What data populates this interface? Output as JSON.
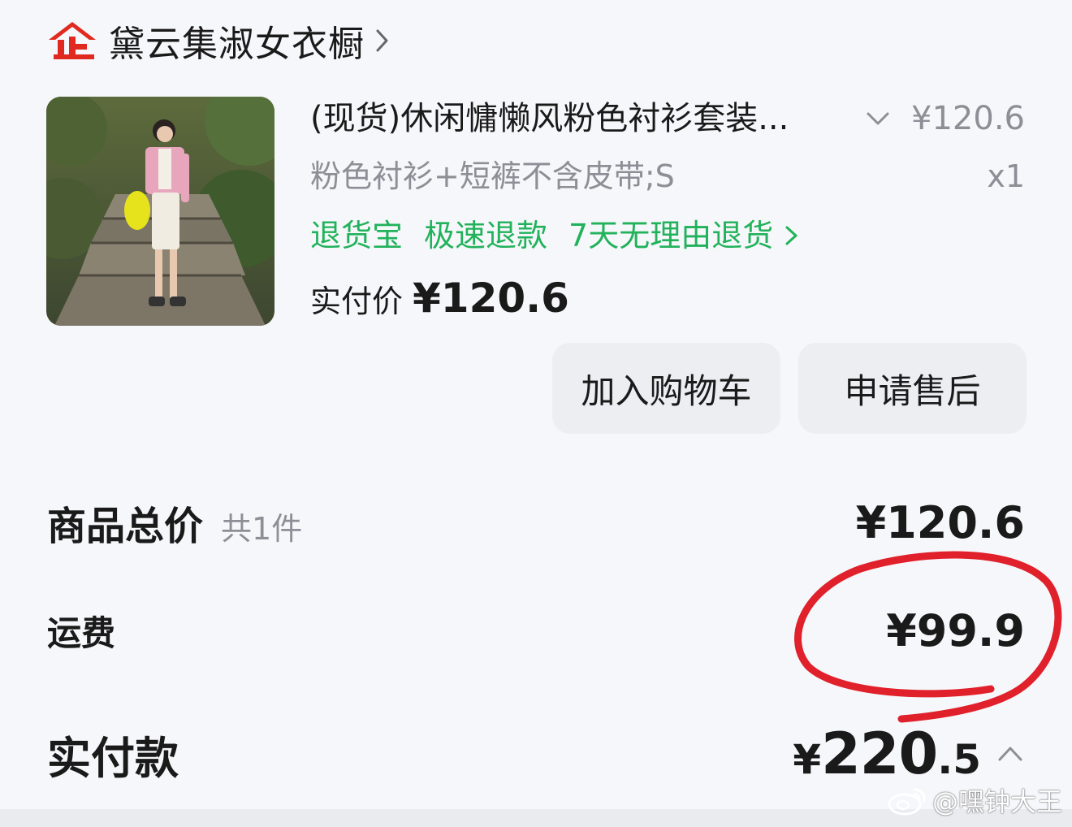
{
  "shop": {
    "name": "黛云集淑女衣橱",
    "logo_icon": "enterprise-shop-icon",
    "logo_text": "企",
    "accent": "#e02a20"
  },
  "product": {
    "title": "(现货)休闲慵懒风粉色衬衫套装...",
    "unit_price": "¥120.6",
    "spec": "粉色衬衫+短裤不含皮带;S",
    "quantity": "x1",
    "services": [
      "退货宝",
      "极速退款",
      "7天无理由退货"
    ],
    "paid_label": "实付价",
    "paid_value": "¥120.6",
    "image_icon": "product-photo"
  },
  "actions": {
    "add_to_cart": "加入购物车",
    "after_sales": "申请售后"
  },
  "summary": {
    "goods_total_label": "商品总价",
    "goods_count": "共1件",
    "goods_total_value": "¥120.6",
    "shipping_label": "运费",
    "shipping_value": "¥99.9",
    "paid_label": "实付款",
    "paid_yen": "¥",
    "paid_int": "220",
    "paid_dec": ".5"
  },
  "watermark": {
    "text": "@嘿钟大王",
    "icon": "weibo-icon"
  },
  "colors": {
    "service_green": "#21b25b",
    "annotation_red": "#e0202a",
    "muted_text": "#8c8f96",
    "button_bg": "#eceef2"
  }
}
